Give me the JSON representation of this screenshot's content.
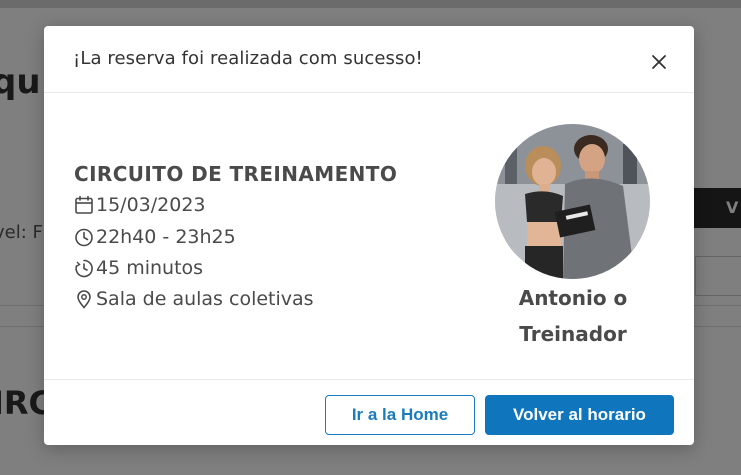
{
  "background": {
    "title_fragment": "qu",
    "dark_button_fragment": "V",
    "level_fragment": "vel: F",
    "heading_fragment": "IRC"
  },
  "modal": {
    "title": "¡La reserva foi realizada com sucesso!",
    "close_label": "X",
    "class_name": "CIRCUITO DE TREINAMENTO",
    "date": "15/03/2023",
    "time": "22h40 - 23h25",
    "duration": "45 minutos",
    "room": "Sala de aulas coletivas",
    "trainer_name": "Antonio o Treinador",
    "buttons": {
      "home": "Ir a la Home",
      "schedule": "Volver al horario"
    }
  },
  "colors": {
    "accent": "#0f75bd",
    "text": "#4a4a4a",
    "overlay": "rgba(0,0,0,0.5)"
  },
  "icons": {
    "date": "calendar-icon",
    "time": "clock-icon",
    "duration": "timer-icon",
    "room": "location-pin-icon",
    "close": "close-icon"
  }
}
